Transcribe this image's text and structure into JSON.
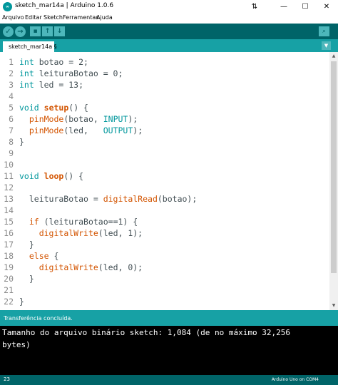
{
  "window": {
    "title": "sketch_mar14a | Arduino 1.0.6",
    "logo": "∞",
    "minimize": "—",
    "maximize": "☐",
    "close": "✕",
    "move_icon": "⇅"
  },
  "menu": [
    "Arquivo",
    "Editar",
    "Sketch",
    "Ferramentas",
    "Ajuda"
  ],
  "toolbar": {
    "verify": "✓",
    "upload": "→",
    "new": "▪",
    "open": "↑",
    "save": "↓",
    "serial_monitor": "⌕"
  },
  "tab": {
    "label": "sketch_mar14a §",
    "menu": "▼"
  },
  "code_lines": [
    {
      "n": "1",
      "parts": [
        [
          "kw",
          "int"
        ],
        [
          "t",
          " botao = 2;"
        ]
      ]
    },
    {
      "n": "2",
      "parts": [
        [
          "kw",
          "int"
        ],
        [
          "t",
          " leituraBotao = 0;"
        ]
      ]
    },
    {
      "n": "3",
      "parts": [
        [
          "kw",
          "int"
        ],
        [
          "t",
          " led = 13;"
        ]
      ]
    },
    {
      "n": "4",
      "parts": []
    },
    {
      "n": "5",
      "parts": [
        [
          "kw",
          "void"
        ],
        [
          "t",
          " "
        ],
        [
          "kw2",
          "setup"
        ],
        [
          "t",
          "() {"
        ]
      ]
    },
    {
      "n": "6",
      "parts": [
        [
          "t",
          "  "
        ],
        [
          "fn",
          "pinMode"
        ],
        [
          "t",
          "(botao, "
        ],
        [
          "const",
          "INPUT"
        ],
        [
          "t",
          ");"
        ]
      ]
    },
    {
      "n": "7",
      "parts": [
        [
          "t",
          "  "
        ],
        [
          "fn",
          "pinMode"
        ],
        [
          "t",
          "(led,   "
        ],
        [
          "const",
          "OUTPUT"
        ],
        [
          "t",
          ");"
        ]
      ]
    },
    {
      "n": "8",
      "parts": [
        [
          "t",
          "}"
        ]
      ]
    },
    {
      "n": "9",
      "parts": []
    },
    {
      "n": "10",
      "parts": []
    },
    {
      "n": "11",
      "parts": [
        [
          "kw",
          "void"
        ],
        [
          "t",
          " "
        ],
        [
          "kw2",
          "loop"
        ],
        [
          "t",
          "() {"
        ]
      ]
    },
    {
      "n": "12",
      "parts": []
    },
    {
      "n": "13",
      "parts": [
        [
          "t",
          "  leituraBotao = "
        ],
        [
          "fn",
          "digitalRead"
        ],
        [
          "t",
          "(botao);"
        ]
      ]
    },
    {
      "n": "14",
      "parts": []
    },
    {
      "n": "15",
      "parts": [
        [
          "t",
          "  "
        ],
        [
          "fn",
          "if"
        ],
        [
          "t",
          " (leituraBotao==1) {"
        ]
      ]
    },
    {
      "n": "16",
      "parts": [
        [
          "t",
          "    "
        ],
        [
          "fn",
          "digitalWrite"
        ],
        [
          "t",
          "(led, 1);"
        ]
      ]
    },
    {
      "n": "17",
      "parts": [
        [
          "t",
          "  }"
        ]
      ]
    },
    {
      "n": "18",
      "parts": [
        [
          "t",
          "  "
        ],
        [
          "fn",
          "else"
        ],
        [
          "t",
          " {"
        ]
      ]
    },
    {
      "n": "19",
      "parts": [
        [
          "t",
          "    "
        ],
        [
          "fn",
          "digitalWrite"
        ],
        [
          "t",
          "(led, 0);"
        ]
      ]
    },
    {
      "n": "20",
      "parts": [
        [
          "t",
          "  }"
        ]
      ]
    },
    {
      "n": "21",
      "parts": []
    },
    {
      "n": "22",
      "parts": [
        [
          "t",
          "}"
        ]
      ]
    }
  ],
  "status": "Transferência concluída.",
  "console": [
    "Tamanho do arquivo binário sketch: 1,084 (de no máximo 32,256",
    "bytes)"
  ],
  "footer": {
    "line": "23",
    "board": "Arduino Uno on COM4"
  },
  "scroll": {
    "up": "▲",
    "down": "▼"
  }
}
